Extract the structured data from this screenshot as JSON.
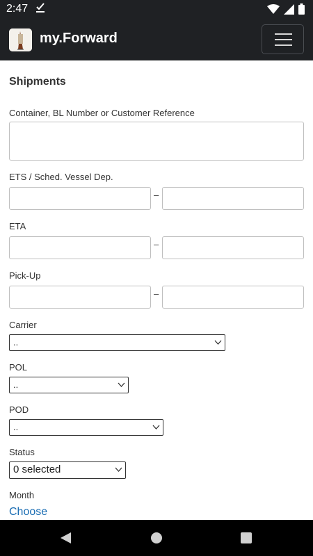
{
  "status_bar": {
    "time": "2:47"
  },
  "app": {
    "title": "my.Forward"
  },
  "page": {
    "title": "Shipments"
  },
  "form": {
    "reference": {
      "label": "Container, BL Number or Customer Reference",
      "value": ""
    },
    "ets": {
      "label": "ETS / Sched. Vessel Dep.",
      "separator": "–"
    },
    "eta": {
      "label": "ETA",
      "separator": "–"
    },
    "pickup": {
      "label": "Pick-Up",
      "separator": "–"
    },
    "carrier": {
      "label": "Carrier",
      "value": ".."
    },
    "pol": {
      "label": "POL",
      "value": ".."
    },
    "pod": {
      "label": "POD",
      "value": ".."
    },
    "status": {
      "label": "Status",
      "value": "0 selected"
    },
    "month": {
      "label": "Month",
      "link": "Choose"
    }
  },
  "colors": {
    "bar": "#1f2124",
    "link": "#1a6db3"
  }
}
